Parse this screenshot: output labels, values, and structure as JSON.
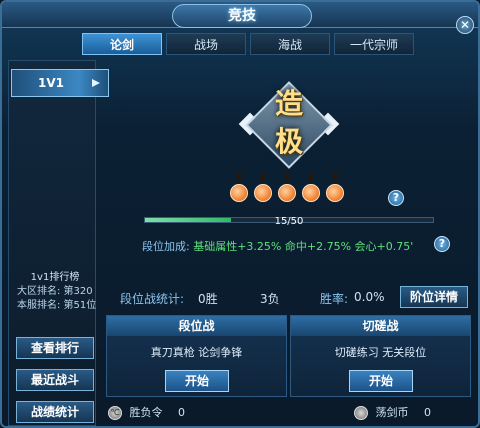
{
  "window": {
    "title": "竞技"
  },
  "tabs": [
    {
      "label": "论剑",
      "active": true
    },
    {
      "label": "战场",
      "active": false
    },
    {
      "label": "海战",
      "active": false
    },
    {
      "label": "一代宗师",
      "active": false
    }
  ],
  "sidebar": {
    "mode_label": "1V1",
    "rank_title": "1v1排行榜",
    "rank_region": "大区排名: 第320",
    "rank_server": "本服排名: 第51位",
    "buttons": [
      "查看排行",
      "最近战斗",
      "战绩统计"
    ]
  },
  "tier": {
    "char1": "造",
    "char2": "极",
    "flames_count": 5,
    "progress_text": "15/50",
    "progress_current": 15,
    "progress_max": 50,
    "bonus_label": "段位加成:",
    "bonus_value": "基础属性+3.25% 命中+2.75% 会心+0.75'"
  },
  "stats": {
    "label": "段位战统计:",
    "wins": "0胜",
    "losses": "3负",
    "rate_label": "胜率:",
    "rate_value": "0.0%",
    "detail_button": "阶位详情"
  },
  "modes": [
    {
      "title": "段位战",
      "desc": "真刀真枪 论剑争锋",
      "button": "开始"
    },
    {
      "title": "切磋战",
      "desc": "切磋练习 无关段位",
      "button": "开始"
    }
  ],
  "currency": {
    "left_icon_text": "℃",
    "left_label": "胜负令",
    "left_value": "0",
    "right_label": "荡剑币",
    "right_value": "0"
  },
  "colors": {
    "accent": "#3e93d6",
    "bonus_green": "#5fe07a",
    "bonus_label": "#8cc5ee"
  }
}
